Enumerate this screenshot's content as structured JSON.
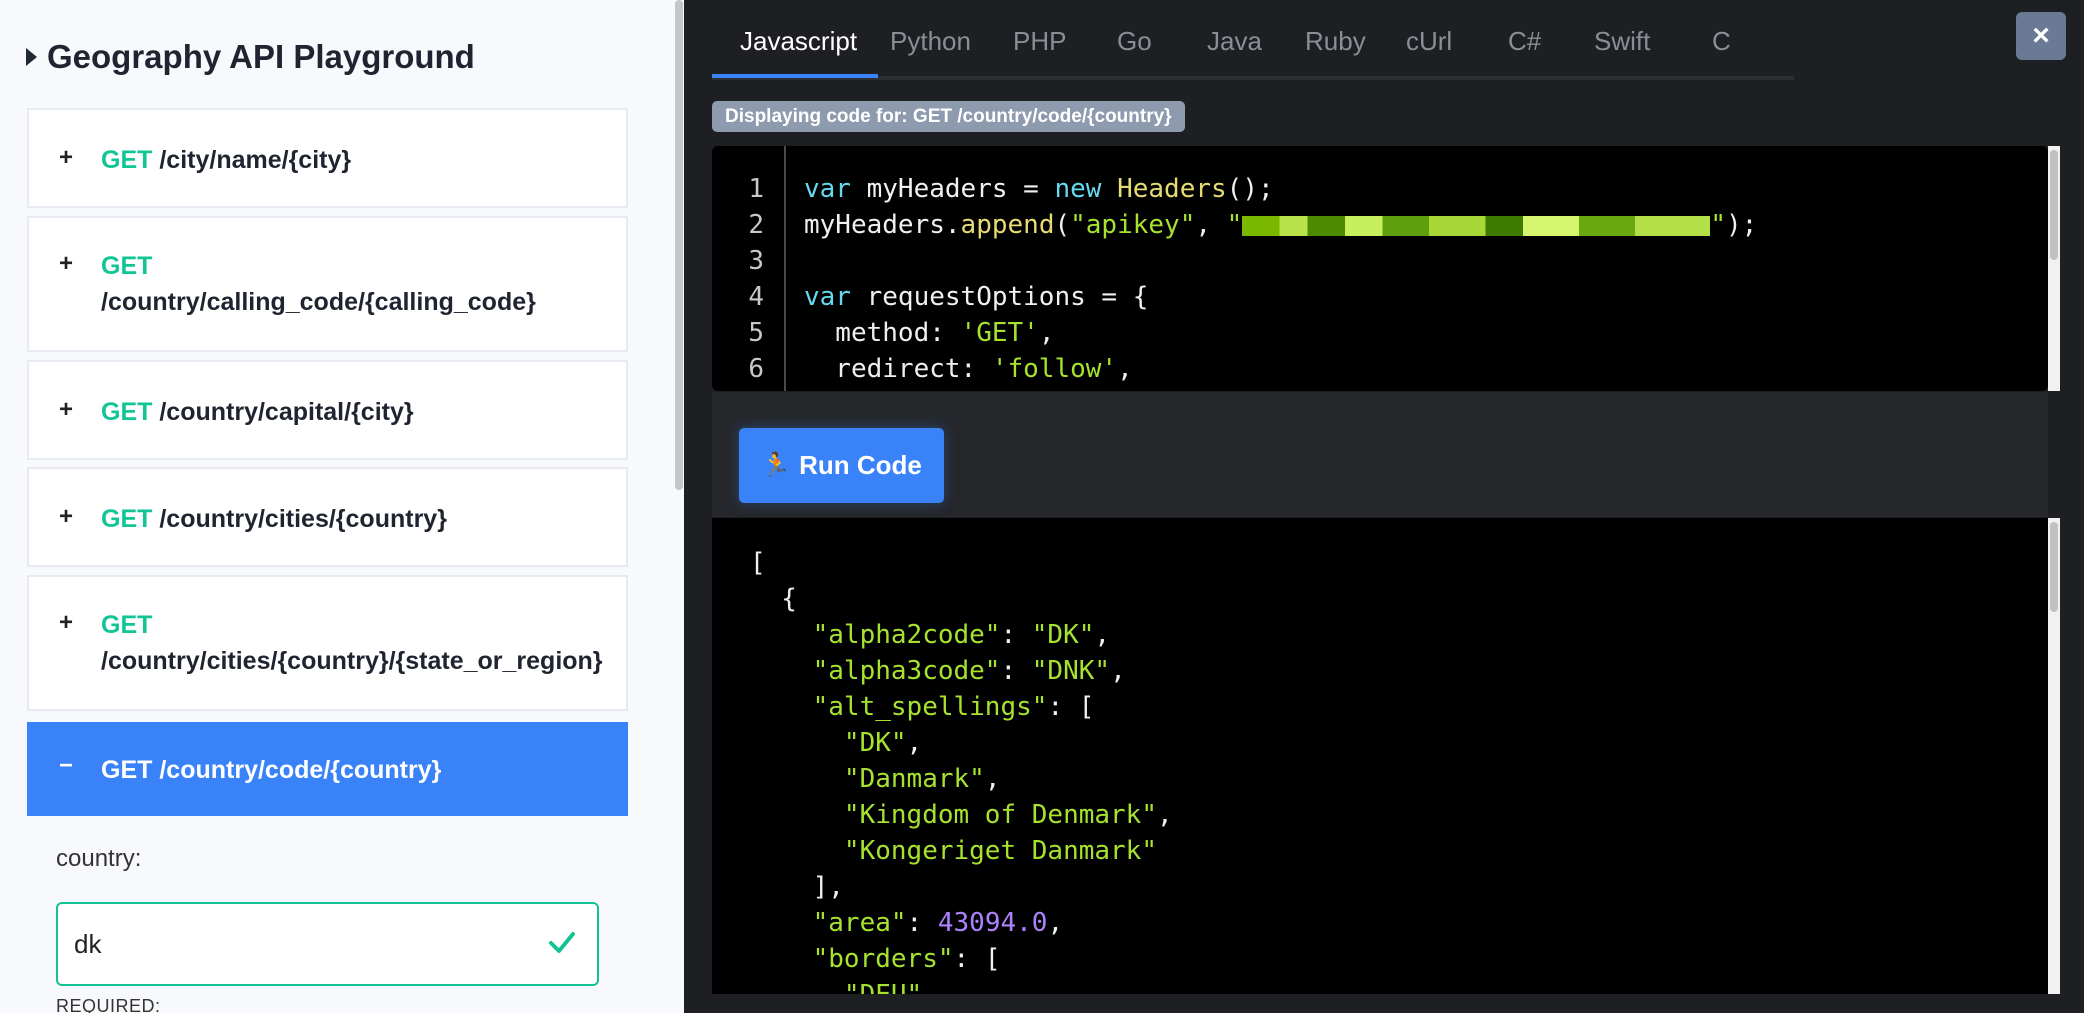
{
  "left": {
    "title": "Geography API Playground",
    "endpoints": [
      {
        "method": "GET",
        "path": "/city/name/{city}",
        "sign": "+"
      },
      {
        "method": "GET",
        "path": "/country/calling_code/{calling_code}",
        "sign": "+"
      },
      {
        "method": "GET",
        "path": "/country/capital/{city}",
        "sign": "+"
      },
      {
        "method": "GET",
        "path": "/country/cities/{country}",
        "sign": "+"
      },
      {
        "method": "GET",
        "path": "/country/cities/{country}/{state_or_region}",
        "sign": "+"
      },
      {
        "method": "GET",
        "path": "/country/code/{country}",
        "sign": "−"
      }
    ],
    "param_label": "country:",
    "param_value": "dk",
    "required_label": "REQUIRED:"
  },
  "right": {
    "tabs": [
      "Javascript",
      "Python",
      "PHP",
      "Go",
      "Java",
      "Ruby",
      "cUrl",
      "C#",
      "Swift",
      "C"
    ],
    "active_tab": "Javascript",
    "close_label": "×",
    "badge": "Displaying code for: GET /country/code/{country}",
    "code_lines": [
      "1",
      "2",
      "3",
      "4",
      "5",
      "6"
    ],
    "code": {
      "l1_kw": "var",
      "l1_a": " myHeaders = ",
      "l1_kw2": "new",
      "l1_fn": " Headers",
      "l1_b": "();",
      "l2_a": "myHeaders.",
      "l2_fn": "append",
      "l2_b": "(",
      "l2_s1": "\"apikey\"",
      "l2_c": ", ",
      "l2_s2a": "\"",
      "l2_s2b": "\"",
      "l2_d": ");",
      "l4_kw": "var",
      "l4_a": " requestOptions = {",
      "l5_a": "  method: ",
      "l5_s": "'GET'",
      "l5_b": ",",
      "l6_a": "  redirect: ",
      "l6_s": "'follow'",
      "l6_b": ","
    },
    "run_label": "Run Code",
    "output": {
      "o1": "[",
      "o2": "  {",
      "o3k": "\"alpha2code\"",
      "o3v": "\"DK\"",
      "o4k": "\"alpha3code\"",
      "o4v": "\"DNK\"",
      "o5k": "\"alt_spellings\"",
      "o5b": ": [",
      "o6": "\"DK\"",
      "o7": "\"Danmark\"",
      "o8": "\"Kingdom of Denmark\"",
      "o9": "\"Kongeriget Danmark\"",
      "o10": "],",
      "o11k": "\"area\"",
      "o11v": "43094.0",
      "o12k": "\"borders\"",
      "o12b": ": [",
      "o13": "\"DEU\""
    }
  }
}
